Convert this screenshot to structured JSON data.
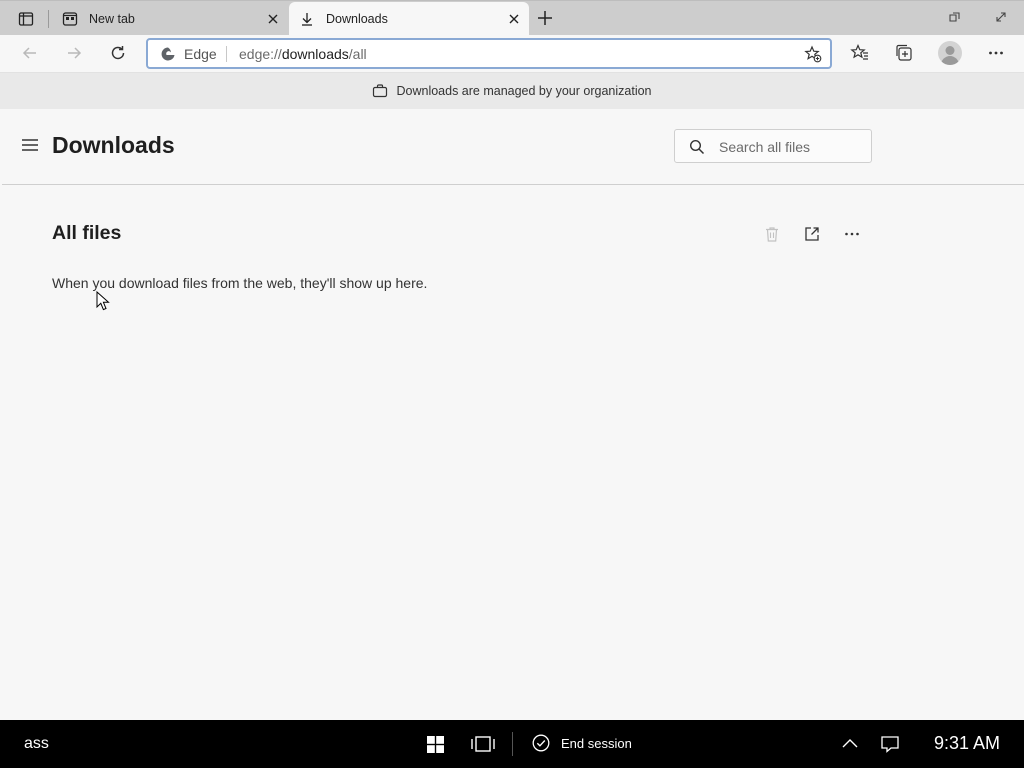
{
  "browser": {
    "tabs": [
      {
        "title": "New tab",
        "icon": "newtab-icon",
        "active": false
      },
      {
        "title": "Downloads",
        "icon": "download-icon",
        "active": true
      }
    ],
    "address_bar": {
      "site_label": "Edge",
      "url_scheme": "edge://",
      "url_host": "downloads",
      "url_path": "/all"
    },
    "managed_notice": "Downloads are managed by your organization"
  },
  "page": {
    "title": "Downloads",
    "search_placeholder": "Search all files",
    "section_title": "All files",
    "empty_message": "When you download files from the web, they'll show up here."
  },
  "taskbar": {
    "user_text": "ass",
    "end_session_label": "End session",
    "clock": "9:31 AM"
  },
  "colors": {
    "tabstrip": "#cdcdcd",
    "page_bg": "#f7f7f7",
    "banner_bg": "#e9e9e9",
    "address_focus": "#8aa9d4",
    "taskbar": "#000000"
  }
}
